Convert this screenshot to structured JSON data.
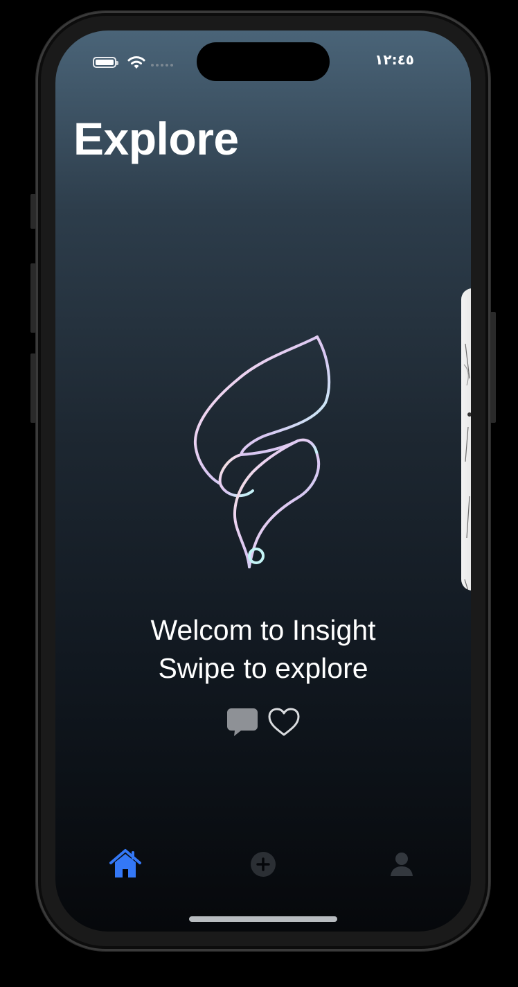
{
  "status_bar": {
    "time": "١٢:٤٥",
    "battery_icon": "battery-full-icon",
    "wifi_icon": "wifi-icon",
    "signal_icon": "cellular-dots-icon"
  },
  "header": {
    "title": "Explore"
  },
  "welcome": {
    "logo_icon": "insight-flame-logo",
    "line1": "Welcom to Insight",
    "line2": "Swipe to explore"
  },
  "actions": {
    "comment_icon": "speech-bubble-icon",
    "like_icon": "heart-outline-icon"
  },
  "tab_bar": {
    "tabs": [
      {
        "icon": "house-icon",
        "active": true
      },
      {
        "icon": "plus-circle-icon",
        "active": false
      },
      {
        "icon": "person-icon",
        "active": false
      }
    ]
  },
  "colors": {
    "accent": "#3478f6",
    "inactive_tab": "#3c4147",
    "text": "#ffffff"
  }
}
